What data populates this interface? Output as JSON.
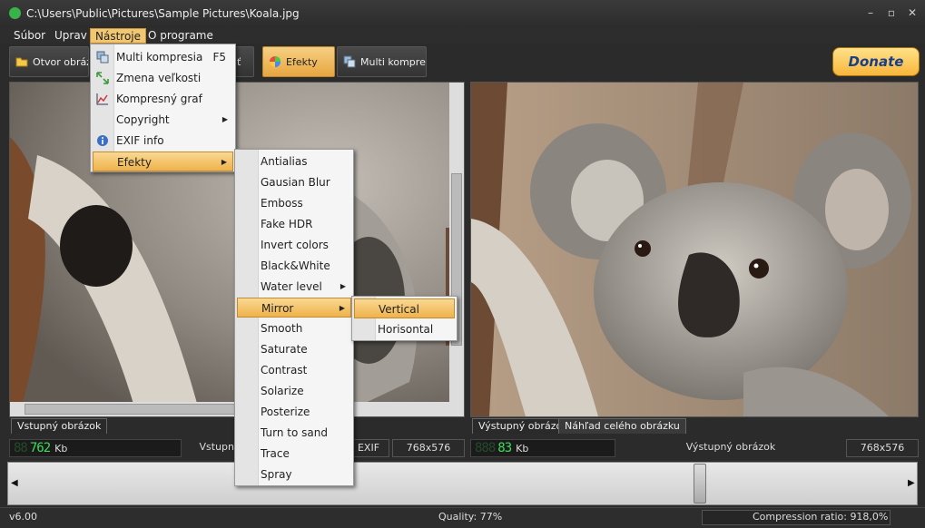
{
  "window": {
    "title": "C:\\Users\\Public\\Pictures\\Sample Pictures\\Koala.jpg",
    "minimize_glyph": "–",
    "maximize_glyph": "▫",
    "close_glyph": "✕"
  },
  "menubar": {
    "items": [
      {
        "label": "Súbor"
      },
      {
        "label": "Uprav"
      },
      {
        "label": "Nástroje"
      },
      {
        "label": "O programe"
      }
    ]
  },
  "toolbar": {
    "open_label": "Otvor obrázok",
    "save_label_partial": "ť",
    "effects_label": "Efekty",
    "multi_label": "Multi kompresia",
    "donate_label": "Donate"
  },
  "tools_menu": {
    "items": [
      {
        "label": "Multi kompresia",
        "shortcut": "F5",
        "icon": "multi-compress-icon"
      },
      {
        "label": "Zmena veľkosti",
        "icon": "resize-icon"
      },
      {
        "label": "Kompresný graf",
        "icon": "chart-icon"
      },
      {
        "label": "Copyright",
        "submenu": true
      },
      {
        "label": "EXIF info",
        "icon": "info-icon"
      },
      {
        "label": "Efekty",
        "submenu": true
      }
    ]
  },
  "effects_menu": {
    "items": [
      {
        "label": "Antialias"
      },
      {
        "label": "Gausian Blur"
      },
      {
        "label": "Emboss"
      },
      {
        "label": "Fake HDR"
      },
      {
        "label": "Invert colors"
      },
      {
        "label": "Black&White"
      },
      {
        "label": "Water level",
        "submenu": true
      },
      {
        "label": "Mirror",
        "submenu": true
      },
      {
        "label": "Smooth"
      },
      {
        "label": "Saturate"
      },
      {
        "label": "Contrast"
      },
      {
        "label": "Solarize"
      },
      {
        "label": "Posterize"
      },
      {
        "label": "Turn to sand"
      },
      {
        "label": "Trace"
      },
      {
        "label": "Spray"
      }
    ]
  },
  "mirror_menu": {
    "items": [
      {
        "label": "Vertical"
      },
      {
        "label": "Horisontal"
      }
    ]
  },
  "left_panel": {
    "tab": "Vstupný obrázok",
    "size_digits": "762",
    "size_ghost": "88",
    "size_unit": "Kb",
    "caption_partial": "Vstupn",
    "exif_label": "EXIF",
    "dimensions": "768x576"
  },
  "right_panel": {
    "tab_output": "Výstupný obrázok",
    "tab_preview": "Náhľad celého obrázku",
    "size_digits": "83",
    "size_ghost": "888",
    "size_unit": "Kb",
    "caption": "Výstupný obrázok",
    "dimensions": "768x576"
  },
  "status": {
    "version": "v6.00",
    "quality": "Quality: 77%",
    "compression": "Compression ratio: 918,0%"
  },
  "slider": {
    "value_fraction": 0.77
  },
  "colors": {
    "accent": "#f2c772",
    "lcd_green": "#3ddc5a"
  }
}
